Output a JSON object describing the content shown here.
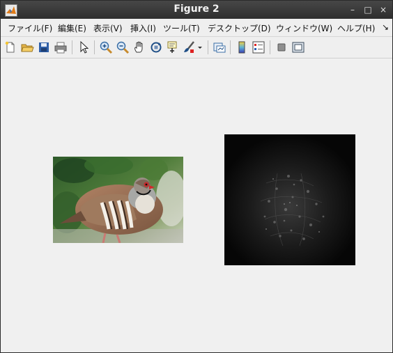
{
  "window": {
    "title": "Figure 2",
    "controls": {
      "close": "×",
      "maximize": "□",
      "minimize": "–"
    }
  },
  "menubar": {
    "items": [
      "ファイル(F)",
      "編集(E)",
      "表示(V)",
      "挿入(I)",
      "ツール(T)",
      "デスクトップ(D)",
      "ウィンドウ(W)",
      "ヘルプ(H)"
    ],
    "overflow": "↘"
  },
  "toolbar": {
    "tools": [
      "new-figure-icon",
      "open-folder-icon",
      "save-icon",
      "print-icon",
      "select-pointer-icon",
      "zoom-in-icon",
      "zoom-out-icon",
      "pan-hand-icon",
      "rotate-3d-icon",
      "data-cursor-icon",
      "brush-icon",
      "brush-dropdown-icon",
      "link-plot-icon",
      "colorbar-icon",
      "legend-icon",
      "hide-plot-tools-icon",
      "show-plot-tools-icon"
    ]
  },
  "figure": {
    "image_left": "partridge-photo",
    "image_right": "fft-magnitude-spectrum"
  }
}
